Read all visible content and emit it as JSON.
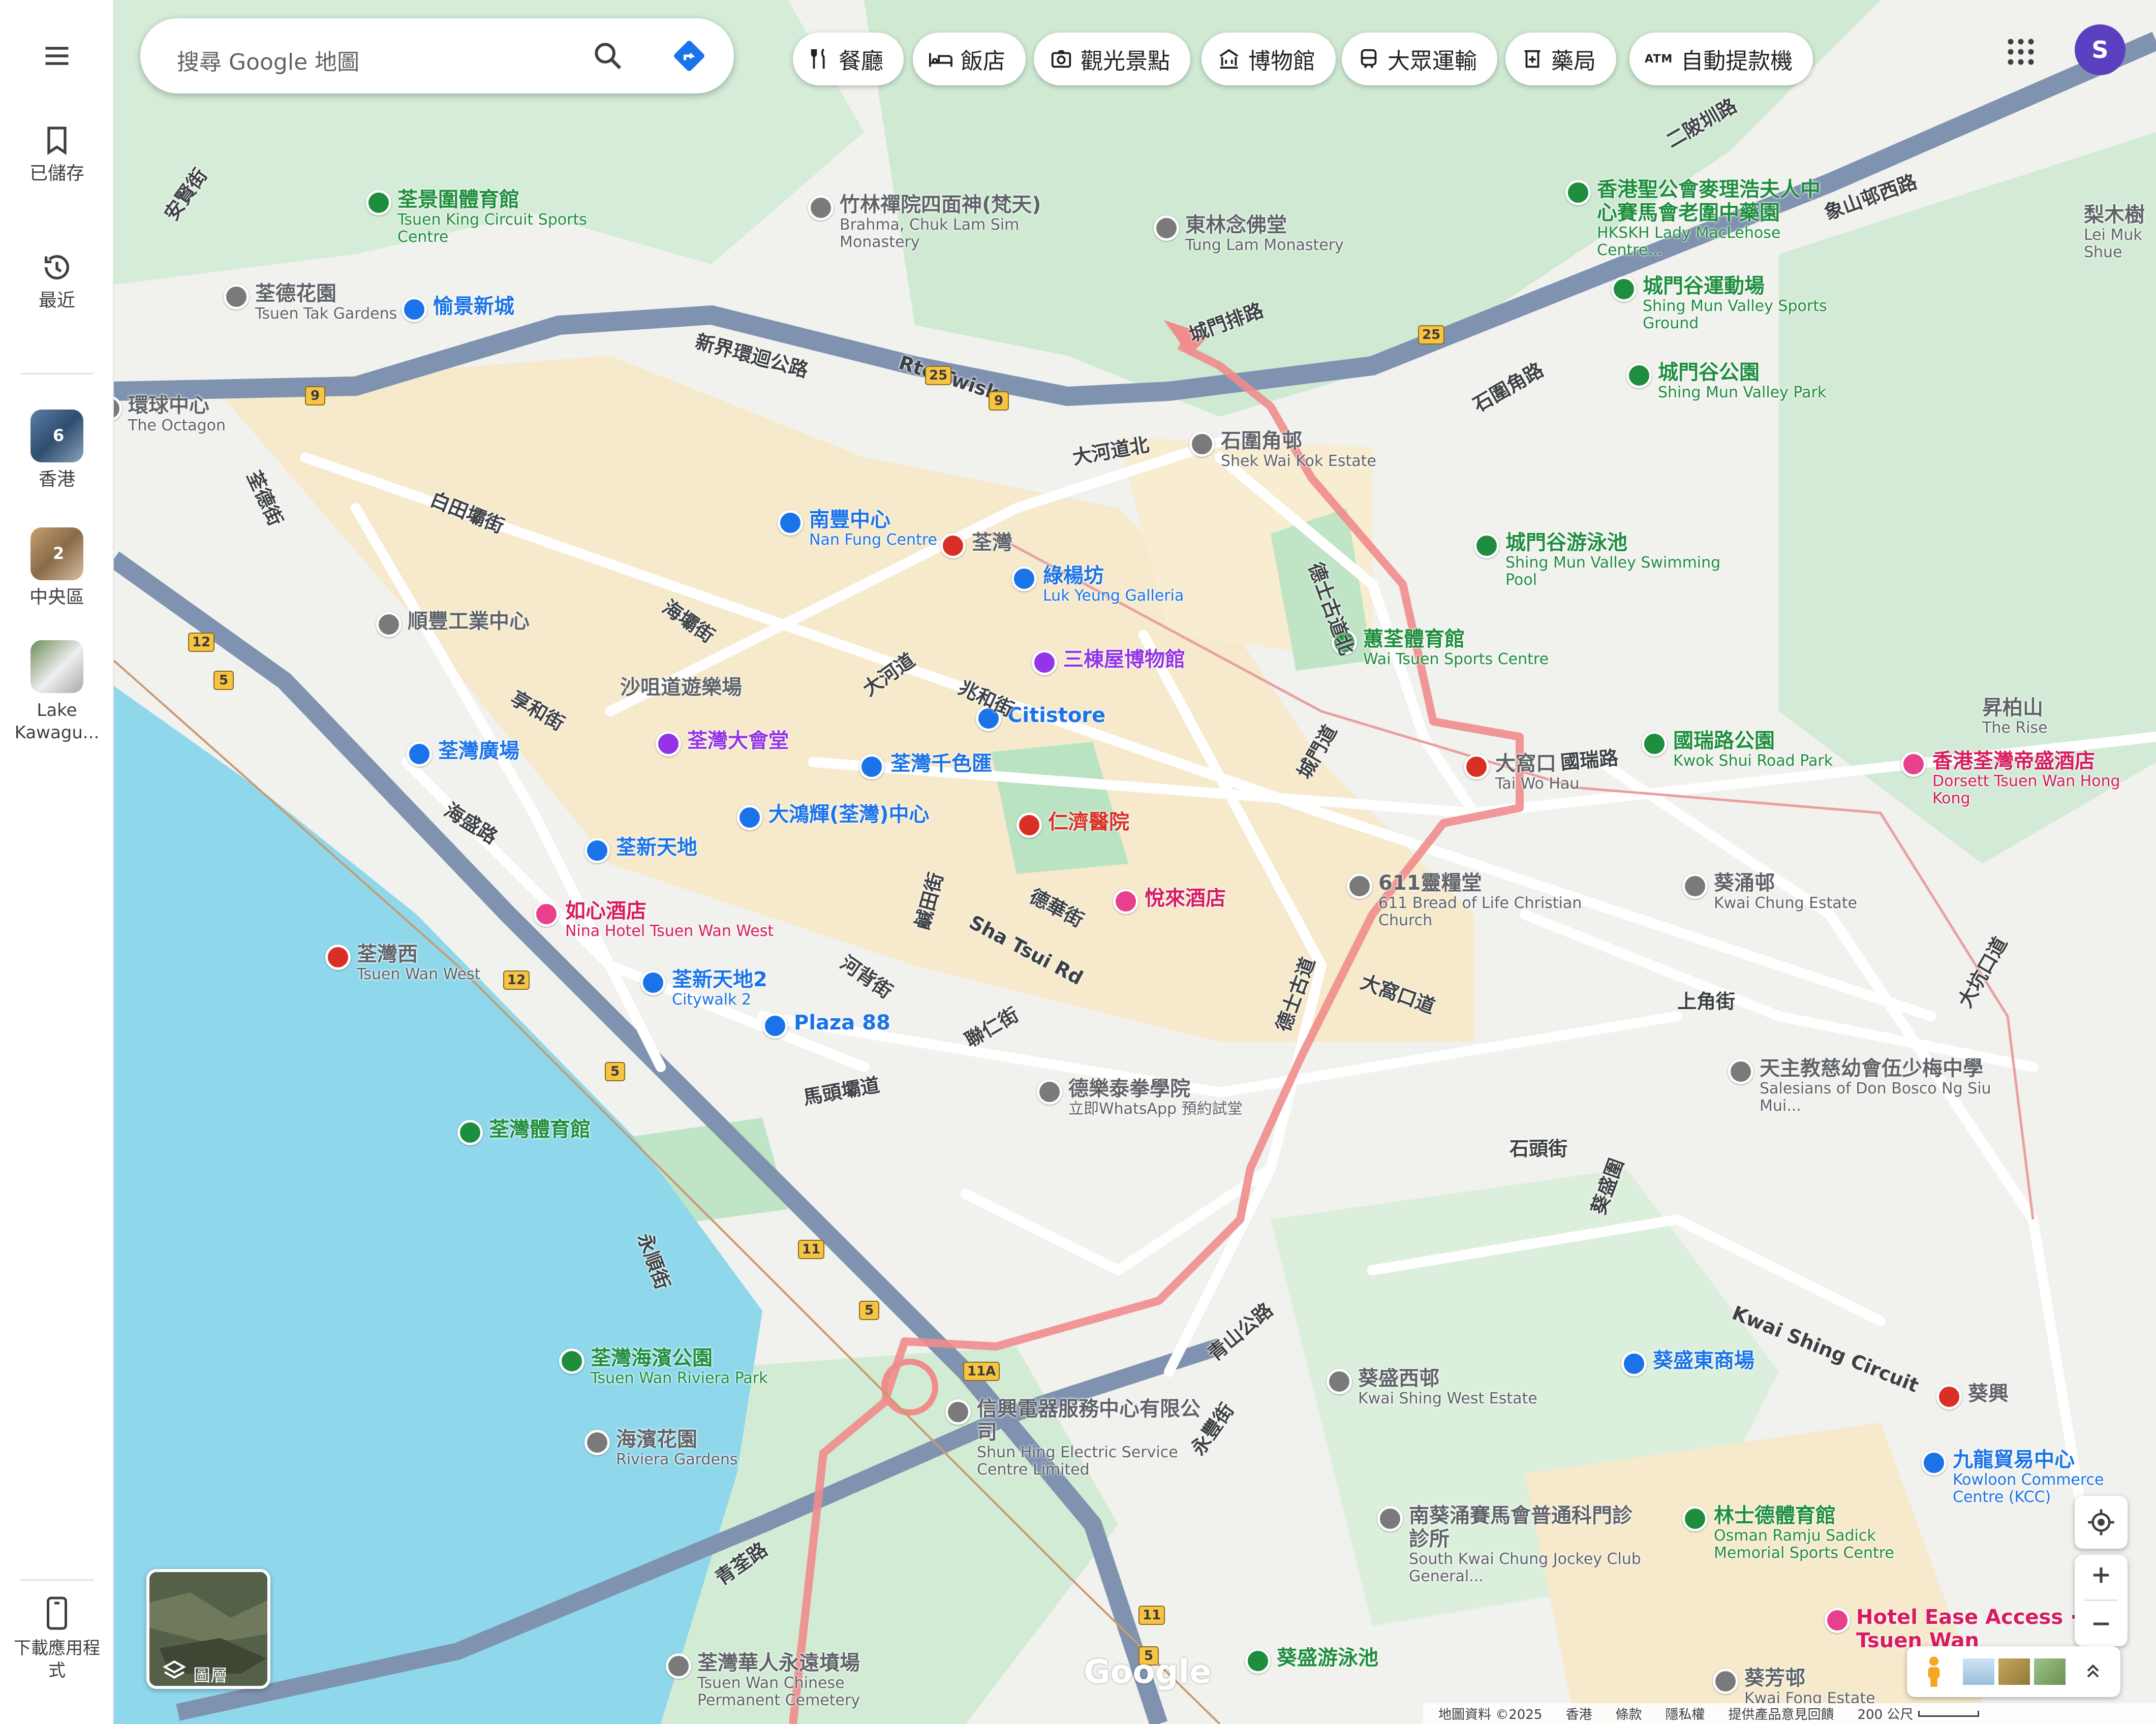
{
  "search": {
    "placeholder": "搜尋 Google 地圖"
  },
  "rail": {
    "saved": "已儲存",
    "recent": "最近",
    "places": [
      {
        "label": "香港",
        "badge": "6"
      },
      {
        "label": "中央區",
        "badge": "2"
      },
      {
        "label": "Lake Kawagu..."
      }
    ],
    "download": "下載應用程式"
  },
  "chips": [
    {
      "label": "餐廳",
      "icon": "restaurant-icon"
    },
    {
      "label": "飯店",
      "icon": "hotel-icon"
    },
    {
      "label": "觀光景點",
      "icon": "camera-icon"
    },
    {
      "label": "博物館",
      "icon": "museum-icon"
    },
    {
      "label": "大眾運輸",
      "icon": "transit-icon"
    },
    {
      "label": "藥局",
      "icon": "pharmacy-icon"
    },
    {
      "label": "自動提款機",
      "icon": "atm-icon"
    }
  ],
  "account": {
    "initial": "S"
  },
  "layers": {
    "label": "圖層"
  },
  "footer": {
    "copyright": "地圖資料 ©2025",
    "region": "香港",
    "terms": "條款",
    "privacy": "隱私權",
    "feedback": "提供產品意見回饋",
    "scale": "200 公尺"
  },
  "logo": "Google",
  "colors": {
    "water": "#8fd8ec",
    "park": "#c6e8cd",
    "urban": "#f6e9cc",
    "highway": "#7f93b0",
    "route": "#f08c8c",
    "accent": "#1a73e8"
  },
  "map": {
    "roads": [
      {
        "text": "新界環迴公路"
      },
      {
        "text": "Rte Twisk"
      },
      {
        "text": "大河道北"
      },
      {
        "text": "白田壩街"
      },
      {
        "text": "海壩街"
      },
      {
        "text": "享和街"
      },
      {
        "text": "海盛路"
      },
      {
        "text": "大河道"
      },
      {
        "text": "兆和街"
      },
      {
        "text": "Sha Tsui Rd"
      },
      {
        "text": "德華街"
      },
      {
        "text": "河背街"
      },
      {
        "text": "鹹田街"
      },
      {
        "text": "聯仁街"
      },
      {
        "text": "馬頭壩道"
      },
      {
        "text": "德士古道北"
      },
      {
        "text": "德士古道"
      },
      {
        "text": "大窩口道"
      },
      {
        "text": "國瑞路"
      },
      {
        "text": "上角街"
      },
      {
        "text": "Kwai Shing Circuit"
      },
      {
        "text": "青荃路"
      },
      {
        "text": "永順街"
      },
      {
        "text": "二陂圳路"
      },
      {
        "text": "城門道"
      },
      {
        "text": "石圍角路"
      },
      {
        "text": "石頭街"
      },
      {
        "text": "葵盛圍"
      },
      {
        "text": "青山公路"
      },
      {
        "text": "永豐街"
      },
      {
        "text": "城門排路"
      },
      {
        "text": "象山邨西路"
      },
      {
        "text": "安賢街"
      },
      {
        "text": "荃德街"
      },
      {
        "text": "大坑口道"
      }
    ],
    "places": [
      {
        "zh": "荃景圍體育館",
        "en": "Tsuen King Circuit Sports Centre",
        "kind": "sports"
      },
      {
        "zh": "竹林禪院四面神(梵天)",
        "en": "Brahma, Chuk Lam Sim Monastery",
        "kind": "temple"
      },
      {
        "zh": "東林念佛堂",
        "en": "Tung Lam Monastery",
        "kind": "temple"
      },
      {
        "zh": "香港聖公會麥理浩夫人中心賽馬會老圍中藥園",
        "en": "HKSKH Lady MacLehose Centre...",
        "kind": "garden"
      },
      {
        "zh": "城門谷運動場",
        "en": "Shing Mun Valley Sports Ground",
        "kind": "sports"
      },
      {
        "zh": "城門谷公園",
        "en": "Shing Mun Valley Park",
        "kind": "park"
      },
      {
        "zh": "荃德花園",
        "en": "Tsuen Tak Gardens",
        "kind": "poi"
      },
      {
        "zh": "愉景新城",
        "en": "",
        "kind": "shop"
      },
      {
        "zh": "環球中心",
        "en": "The Octagon",
        "kind": "poi"
      },
      {
        "zh": "南豐中心",
        "en": "Nan Fung Centre",
        "kind": "shop"
      },
      {
        "zh": "荃灣",
        "en": "",
        "kind": "mtr"
      },
      {
        "zh": "綠楊坊",
        "en": "Luk Yeung Galleria",
        "kind": "shop"
      },
      {
        "zh": "石圍角邨",
        "en": "Shek Wai Kok Estate",
        "kind": "poi"
      },
      {
        "zh": "城門谷游泳池",
        "en": "Shing Mun Valley Swimming Pool",
        "kind": "sports"
      },
      {
        "zh": "三棟屋博物館",
        "en": "",
        "kind": "museum"
      },
      {
        "zh": "蕙荃體育館",
        "en": "Wai Tsuen Sports Centre",
        "kind": "sports"
      },
      {
        "zh": "順豐工業中心",
        "en": "",
        "kind": "poi"
      },
      {
        "zh": "沙咀道遊樂場",
        "en": "",
        "kind": "label"
      },
      {
        "zh": "Citistore",
        "en": "",
        "kind": "shop"
      },
      {
        "zh": "荃灣廣場",
        "en": "",
        "kind": "shop"
      },
      {
        "zh": "荃灣大會堂",
        "en": "",
        "kind": "hall"
      },
      {
        "zh": "荃灣千色匯",
        "en": "",
        "kind": "shop"
      },
      {
        "zh": "大窩口",
        "en": "Tai Wo Hau",
        "kind": "mtr"
      },
      {
        "zh": "國瑞路公園",
        "en": "Kwok Shui Road Park",
        "kind": "park"
      },
      {
        "zh": "香港荃灣帝盛酒店",
        "en": "Dorsett Tsuen Wan Hong Kong",
        "kind": "hotel"
      },
      {
        "zh": "昇柏山",
        "en": "The Rise",
        "kind": "label"
      },
      {
        "zh": "大鴻輝(荃灣)中心",
        "en": "",
        "kind": "shop"
      },
      {
        "zh": "仁濟醫院",
        "en": "",
        "kind": "hospital"
      },
      {
        "zh": "荃新天地",
        "en": "",
        "kind": "shop"
      },
      {
        "zh": "悅來酒店",
        "en": "",
        "kind": "hotel"
      },
      {
        "zh": "611靈糧堂",
        "en": "611 Bread of Life Christian Church",
        "kind": "church"
      },
      {
        "zh": "葵涌邨",
        "en": "Kwai Chung Estate",
        "kind": "poi"
      },
      {
        "zh": "如心酒店",
        "en": "Nina Hotel Tsuen Wan West",
        "kind": "hotel"
      },
      {
        "zh": "荃灣西",
        "en": "Tsuen Wan West",
        "kind": "mtr"
      },
      {
        "zh": "荃新天地2",
        "en": "Citywalk 2",
        "kind": "shop"
      },
      {
        "zh": "Plaza 88",
        "en": "",
        "kind": "shop"
      },
      {
        "zh": "德樂泰拳學院",
        "en": "立即WhatsApp 預約試堂",
        "kind": "ad"
      },
      {
        "zh": "天主教慈幼會伍少梅中學",
        "en": "Salesians of Don Bosco Ng Siu Mui...",
        "kind": "school"
      },
      {
        "zh": "荃灣體育館",
        "en": "",
        "kind": "sports"
      },
      {
        "zh": "荃灣海濱公園",
        "en": "Tsuen Wan Riviera Park",
        "kind": "park"
      },
      {
        "zh": "海濱花園",
        "en": "Riviera Gardens",
        "kind": "poi"
      },
      {
        "zh": "信興電器服務中心有限公司",
        "en": "Shun Hing Electric Service Centre Limited",
        "kind": "poi"
      },
      {
        "zh": "葵盛西邨",
        "en": "Kwai Shing West Estate",
        "kind": "poi"
      },
      {
        "zh": "葵盛東商場",
        "en": "",
        "kind": "shop"
      },
      {
        "zh": "葵興",
        "en": "",
        "kind": "mtr"
      },
      {
        "zh": "九龍貿易中心",
        "en": "Kowloon Commerce Centre (KCC)",
        "kind": "shop"
      },
      {
        "zh": "南葵涌賽馬會普通科門診診所",
        "en": "South Kwai Chung Jockey Club General...",
        "kind": "clinic"
      },
      {
        "zh": "林士德體育館",
        "en": "Osman Ramju Sadick Memorial Sports Centre",
        "kind": "sports"
      },
      {
        "zh": "Hotel Ease Access · Tsuen Wan",
        "en": "",
        "kind": "hotel"
      },
      {
        "zh": "葵盛游泳池",
        "en": "",
        "kind": "sports"
      },
      {
        "zh": "荃灣華人永遠墳場",
        "en": "Tsuen Wan Chinese Permanent Cemetery",
        "kind": "poi"
      },
      {
        "zh": "葵芳邨",
        "en": "Kwai Fong Estate",
        "kind": "poi"
      },
      {
        "zh": "梨木樹",
        "en": "Lei Muk Shue",
        "kind": "label"
      }
    ],
    "shields": [
      {
        "text": "9"
      },
      {
        "text": "9"
      },
      {
        "text": "25"
      },
      {
        "text": "25"
      },
      {
        "text": "12"
      },
      {
        "text": "5"
      },
      {
        "text": "12"
      },
      {
        "text": "5"
      },
      {
        "text": "11"
      },
      {
        "text": "5"
      },
      {
        "text": "11A"
      },
      {
        "text": "11"
      },
      {
        "text": "5"
      }
    ]
  }
}
